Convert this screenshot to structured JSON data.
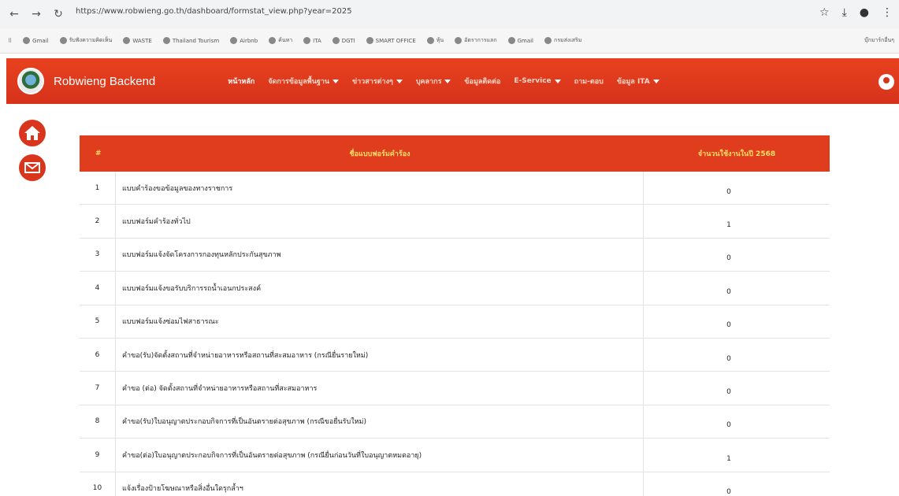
{
  "browser": {
    "url": "https://www.robwieng.go.th/dashboard/formstat_view.php?year=2025",
    "bookmarks": [
      "Gmail",
      "รับฟังความคิดเห็น",
      "WASTE",
      "Thailand Tourism",
      "Airbnb",
      "ค้นหา",
      "ITA",
      "DGTI",
      "SMART OFFICE",
      "หุ้น",
      "อัตราการแลก",
      "Gmail",
      "กรมส่งเสริม"
    ],
    "all_bookmarks_label": "บุ๊กมาร์กอื่นๆ"
  },
  "navbar": {
    "brand": "Robwieng Backend",
    "menu": [
      {
        "label": "หน้าหลัก",
        "dropdown": false,
        "active": true
      },
      {
        "label": "จัดการข้อมูลพื้นฐาน",
        "dropdown": true,
        "active": false
      },
      {
        "label": "ข่าวสารต่างๆ",
        "dropdown": true,
        "active": false
      },
      {
        "label": "บุคลากร",
        "dropdown": true,
        "active": false
      },
      {
        "label": "ข้อมูลติดต่อ",
        "dropdown": false,
        "active": false
      },
      {
        "label": "E-Service",
        "dropdown": true,
        "active": false
      },
      {
        "label": "ถาม-ตอบ",
        "dropdown": false,
        "active": false
      },
      {
        "label": "ข้อมูล ITA",
        "dropdown": true,
        "active": false
      }
    ]
  },
  "table": {
    "headers": {
      "no": "#",
      "name": "ชื่อแบบฟอร์มคำร้อง",
      "count": "จำนวนใช้งานในปี 2568"
    },
    "rows": [
      {
        "no": "1",
        "name": "แบบคำร้องขอข้อมูลของทางราชการ",
        "count": "0"
      },
      {
        "no": "2",
        "name": "แบบฟอร์มคำร้องทั่วไป",
        "count": "1"
      },
      {
        "no": "3",
        "name": "แบบฟอร์มแจ้งจัดโครงการกองทุนหลักประกันสุขภาพ",
        "count": "0"
      },
      {
        "no": "4",
        "name": "แบบฟอร์มแจ้งขอรับบริการรถน้ำเอนกประสงค์",
        "count": "0"
      },
      {
        "no": "5",
        "name": "แบบฟอร์มแจ้งซ่อมไฟสาธารณะ",
        "count": "0"
      },
      {
        "no": "6",
        "name": "คำขอ(รับ)จัดตั้งสถานที่จำหน่ายอาหารหรือสถานที่สะสมอาหาร (กรณียื่นรายใหม่)",
        "count": "0"
      },
      {
        "no": "7",
        "name": "คำขอ (ต่อ) จัดตั้งสถานที่จำหน่ายอาหารหรือสถานที่สะสมอาหาร",
        "count": "0"
      },
      {
        "no": "8",
        "name": "คำขอ(รับ)ใบอนุญาตประกอบกิจการที่เป็นอันตรายต่อสุขภาพ (กรณีขอยื่นรับใหม่)",
        "count": "0"
      },
      {
        "no": "9",
        "name": "คำขอ(ต่อ)ใบอนุญาตประกอบกิจการที่เป็นอันตรายต่อสุขภาพ (กรณียื่นก่อนวันที่ใบอนุญาตหมดอายุ)",
        "count": "1"
      },
      {
        "no": "10",
        "name": "แจ้งเรื่องป้ายโฆษณาหรือสิ่งอื่นใดรุกล้ำฯ",
        "count": "0"
      }
    ]
  }
}
